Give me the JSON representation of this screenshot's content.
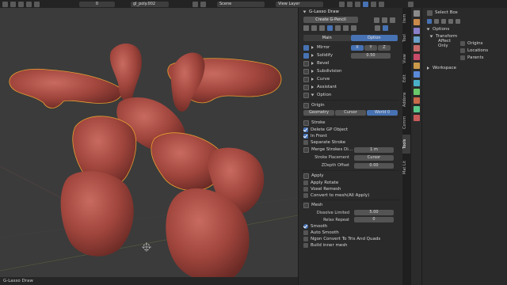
{
  "topbar": {
    "frame": "0",
    "object_name": "gl_poly.002",
    "scene": "Scene",
    "view_layer": "View Layer"
  },
  "statusbar": {
    "label": "G-Lasso Draw"
  },
  "npanel": {
    "title": "G-Lasso Draw",
    "create_button": "Create G-Pencil",
    "tabs": [
      "Main",
      "Option"
    ],
    "options": [
      {
        "label": "Mirror",
        "x": "X",
        "y": "Y",
        "z": "Z"
      },
      {
        "label": "Solidify",
        "value": "0.50"
      },
      {
        "label": "Bevel"
      },
      {
        "label": "Subdivision"
      },
      {
        "label": "Curve"
      },
      {
        "label": "Assistant"
      },
      {
        "label": "Option"
      }
    ],
    "origin": {
      "label": "Origin",
      "buttons": [
        "Geometry",
        "Cursor",
        "World 0"
      ]
    },
    "stroke": {
      "label": "Stroke",
      "delete_gp": "Delete GP Object",
      "in_front": "In Front",
      "separate": "Separate Stroke",
      "merge_label": "Merge Strokes Di...",
      "merge_value": "1 m",
      "placement_label": "Stroke Placement",
      "placement_value": "Cursor",
      "zdepth_label": "ZDepth Offset",
      "zdepth_value": "0.00"
    },
    "apply": {
      "label": "Apply",
      "rotate": "Apply Rotate",
      "voxel": "Voxel Remesh",
      "convert": "Convert to mesh(All Apply)"
    },
    "mesh": {
      "label": "Mesh",
      "dissolve_label": "Dissolve Limited",
      "dissolve_value": "5.00",
      "relax_label": "Relax Repeat",
      "relax_value": "0",
      "smooth": "Smooth",
      "auto_smooth": "Auto Smooth",
      "ngon": "Ngon Convert To Tris And Quads",
      "build_inner": "Build inner mesh"
    }
  },
  "vtabs": [
    "Item",
    "Tool",
    "View",
    "Edit",
    "Addons",
    "Comm",
    "Tools",
    "Mat Lit"
  ],
  "props": {
    "header": "Select Box",
    "options": "Options",
    "transform": "Transform",
    "affect_only": "Affect Only",
    "origins": "Origins",
    "locations": "Locations",
    "parents": "Parents",
    "workspace": "Workspace"
  },
  "colors": {
    "accent": "#4772b3",
    "mesh": "#a84a42",
    "selection": "#e8a030"
  }
}
